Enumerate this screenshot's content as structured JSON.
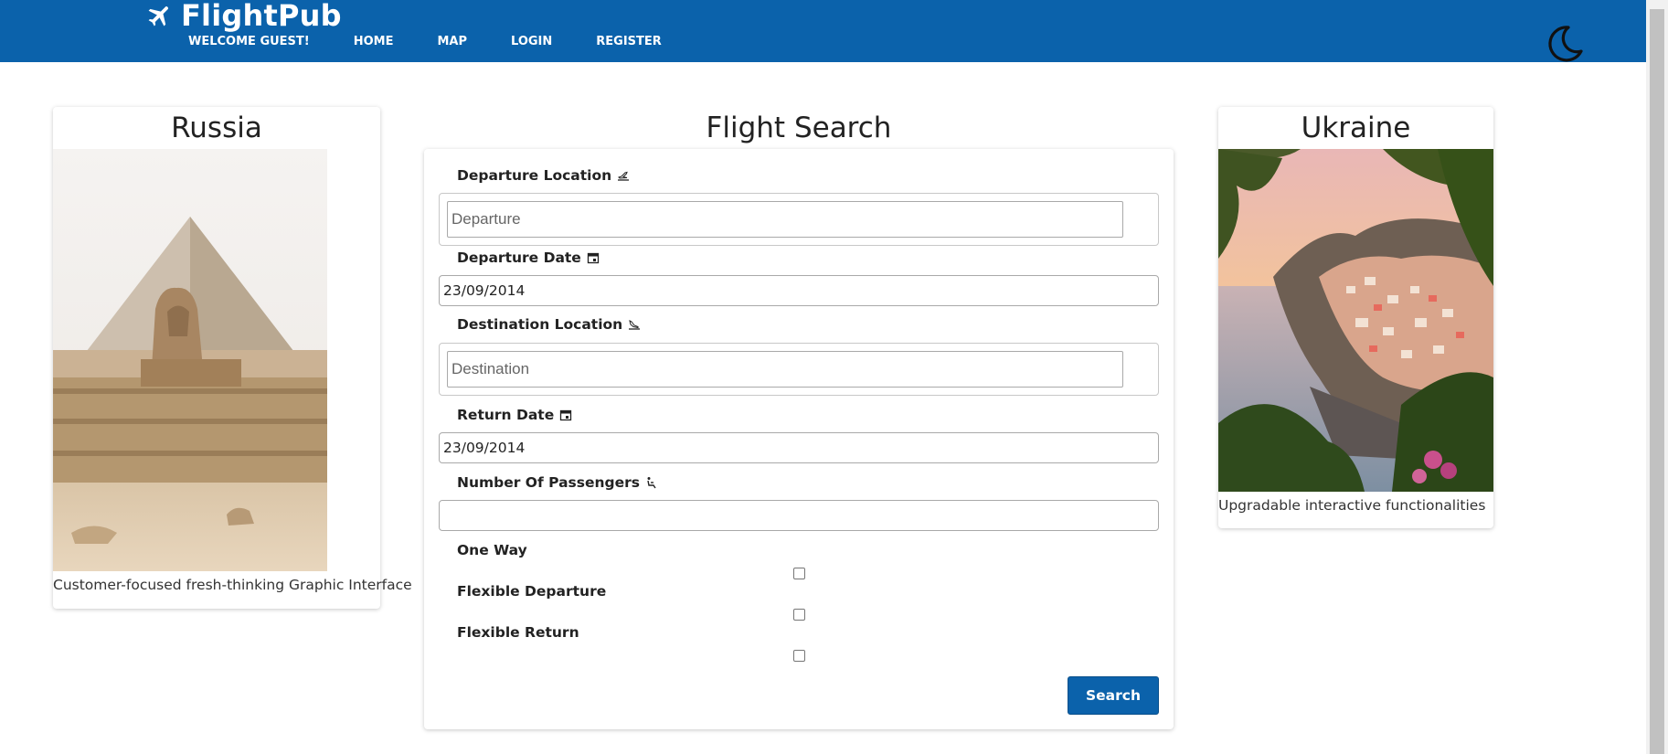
{
  "header": {
    "brand": "FlightPub",
    "nav": [
      "WELCOME GUEST!",
      "HOME",
      "MAP",
      "LOGIN",
      "REGISTER"
    ]
  },
  "left_card": {
    "title": "Russia",
    "caption": "Customer-focused fresh-thinking Graphic Interface"
  },
  "right_card": {
    "title": "Ukraine",
    "caption": "Upgradable interactive functionalities"
  },
  "search": {
    "title": "Flight Search",
    "departure_location_label": "Departure Location",
    "departure_placeholder": "Departure",
    "departure_date_label": "Departure Date",
    "departure_date_value": "23/09/2014",
    "destination_location_label": "Destination Location",
    "destination_placeholder": "Destination",
    "return_date_label": "Return Date",
    "return_date_value": "23/09/2014",
    "passengers_label": "Number Of Passengers",
    "passengers_value": "",
    "one_way_label": "One Way",
    "flexible_departure_label": "Flexible Departure",
    "flexible_return_label": "Flexible Return",
    "search_button": "Search"
  },
  "colors": {
    "primary": "#0b62ab"
  },
  "icons": {
    "brand": "airplane-icon",
    "theme_toggle": "moon-icon",
    "departure": "plane-departure-icon",
    "date": "calendar-icon",
    "arrival": "plane-arrival-icon",
    "passengers": "seat-icon"
  }
}
